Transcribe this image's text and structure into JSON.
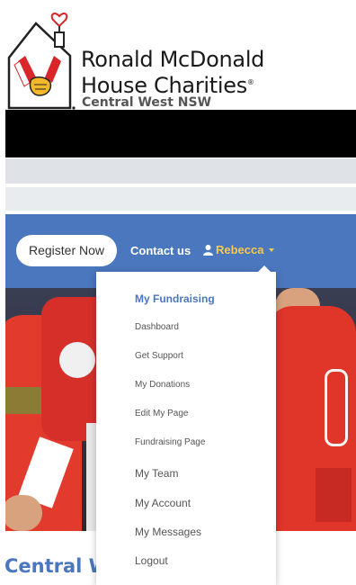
{
  "brand": {
    "name_line1": "Ronald McDonald",
    "name_line2": "House Charities",
    "reg_mark": "®",
    "region": "Central West NSW"
  },
  "nav": {
    "register_label": "Register Now",
    "contact_label": "Contact us",
    "user_label": "Rebecca"
  },
  "dropdown": {
    "header": "My Fundraising",
    "sub_items": [
      "Dashboard",
      "Get Support",
      "My Donations",
      "Edit My Page",
      "Fundraising Page"
    ],
    "items": [
      "My Team",
      "My Account",
      "My Messages",
      "Logout"
    ]
  },
  "page": {
    "heading": "Central W"
  },
  "colors": {
    "nav_blue": "#4a77bd",
    "user_gold": "#f7c948",
    "brand_red": "#d9262a",
    "brand_yellow": "#f3b92b"
  }
}
